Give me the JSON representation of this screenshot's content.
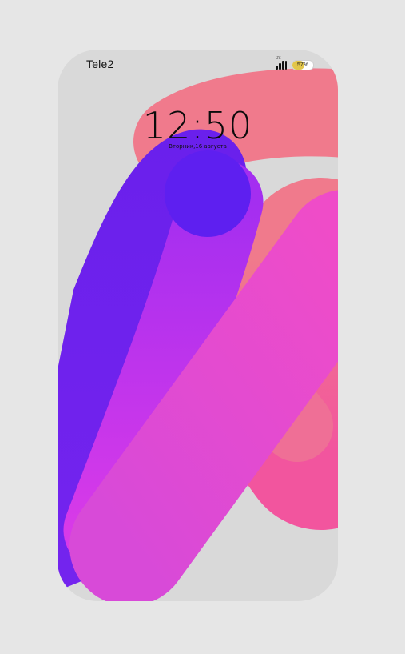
{
  "status_bar": {
    "carrier": "Tele2",
    "network_tag": "LTE",
    "battery_text": "57%",
    "battery_level": 0.57,
    "battery_color": "#e2c64a"
  },
  "lock_screen": {
    "time": "12:50",
    "date": "Вторник,16 августа"
  },
  "wallpaper": {
    "colors": [
      "#6a1ef0",
      "#d22ef2",
      "#f07a8c",
      "#f2559e"
    ]
  }
}
